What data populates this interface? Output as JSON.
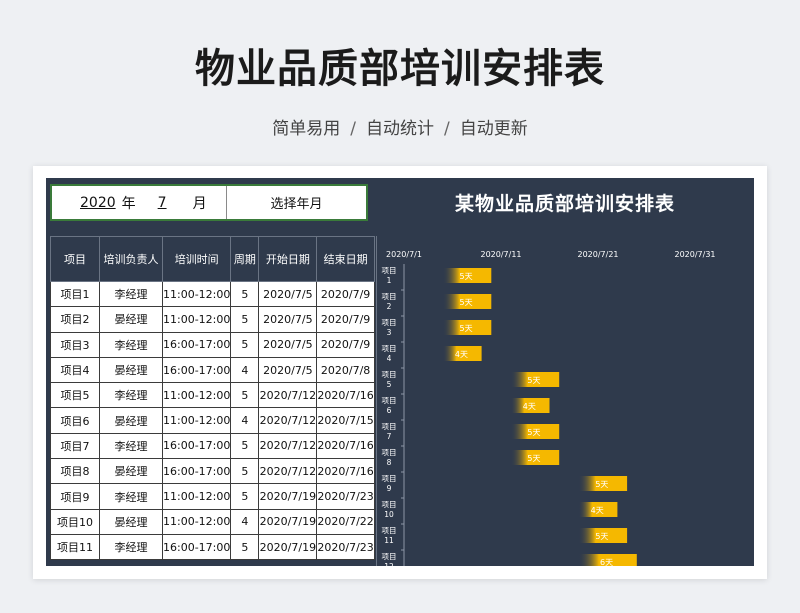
{
  "header": {
    "title": "物业品质部培训安排表",
    "subtitle_parts": [
      "简单易用",
      "自动统计",
      "自动更新"
    ],
    "separator": "/"
  },
  "controls": {
    "year": "2020",
    "year_unit": "年",
    "month": "7",
    "month_unit": "月",
    "select_button": "选择年月"
  },
  "chart_title": "某物业品质部培训安排表",
  "table": {
    "columns": [
      "项目",
      "培训负责人",
      "培训时间",
      "周期",
      "开始日期",
      "结束日期"
    ],
    "rows": [
      [
        "项目1",
        "李经理",
        "11:00-12:00",
        "5",
        "2020/7/5",
        "2020/7/9"
      ],
      [
        "项目2",
        "晏经理",
        "11:00-12:00",
        "5",
        "2020/7/5",
        "2020/7/9"
      ],
      [
        "项目3",
        "李经理",
        "16:00-17:00",
        "5",
        "2020/7/5",
        "2020/7/9"
      ],
      [
        "项目4",
        "晏经理",
        "16:00-17:00",
        "4",
        "2020/7/5",
        "2020/7/8"
      ],
      [
        "项目5",
        "李经理",
        "11:00-12:00",
        "5",
        "2020/7/12",
        "2020/7/16"
      ],
      [
        "项目6",
        "晏经理",
        "11:00-12:00",
        "4",
        "2020/7/12",
        "2020/7/15"
      ],
      [
        "项目7",
        "李经理",
        "16:00-17:00",
        "5",
        "2020/7/12",
        "2020/7/16"
      ],
      [
        "项目8",
        "晏经理",
        "16:00-17:00",
        "5",
        "2020/7/12",
        "2020/7/16"
      ],
      [
        "项目9",
        "李经理",
        "11:00-12:00",
        "5",
        "2020/7/19",
        "2020/7/23"
      ],
      [
        "项目10",
        "晏经理",
        "11:00-12:00",
        "4",
        "2020/7/19",
        "2020/7/22"
      ],
      [
        "项目11",
        "李经理",
        "16:00-17:00",
        "5",
        "2020/7/19",
        "2020/7/23"
      ]
    ]
  },
  "chart_data": {
    "type": "bar",
    "orientation": "horizontal-gantt",
    "x_ticks": [
      "2020/7/1",
      "2020/7/11",
      "2020/7/21",
      "2020/7/31"
    ],
    "xlim": [
      "2020/7/1",
      "2020/7/31"
    ],
    "categories": [
      "项目\n1",
      "项目\n2",
      "项目\n3",
      "项目\n4",
      "项目\n5",
      "项目\n6",
      "项目\n7",
      "项目\n8",
      "项目\n9",
      "项目\n10",
      "项目\n11",
      "项目\n12"
    ],
    "start_dates": [
      "2020/7/5",
      "2020/7/5",
      "2020/7/5",
      "2020/7/5",
      "2020/7/12",
      "2020/7/12",
      "2020/7/12",
      "2020/7/12",
      "2020/7/19",
      "2020/7/19",
      "2020/7/19",
      "2020/7/19"
    ],
    "durations": [
      5,
      5,
      5,
      4,
      5,
      4,
      5,
      5,
      5,
      4,
      5,
      6
    ],
    "labels": [
      "5天",
      "5天",
      "5天",
      "4天",
      "5天",
      "4天",
      "5天",
      "5天",
      "5天",
      "4天",
      "5天",
      "6天"
    ],
    "bar_color": "#f5b800",
    "label_color": "#ffffff"
  }
}
